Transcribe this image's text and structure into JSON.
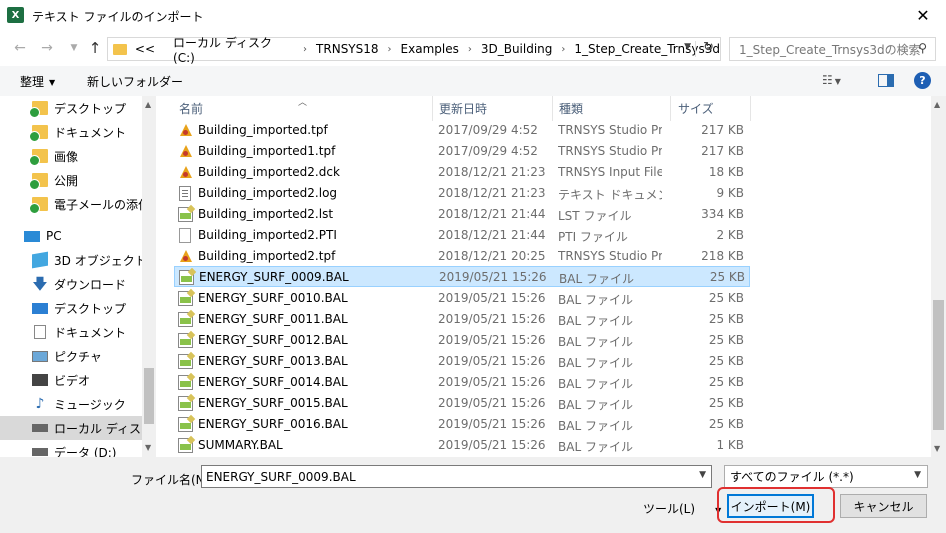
{
  "window": {
    "app_icon_letter": "X",
    "title": "テキスト ファイルのインポート",
    "close_glyph": "✕"
  },
  "address_bar": {
    "overflow": "<<",
    "crumbs": [
      "ローカル ディスク (C:)",
      "TRNSYS18",
      "Examples",
      "3D_Building",
      "1_Step_Create_Trnsys3d"
    ],
    "search_placeholder": "1_Step_Create_Trnsys3dの検索"
  },
  "toolbar": {
    "organize_label": "整理",
    "new_folder_label": "新しいフォルダー"
  },
  "nav_pane": {
    "items": [
      {
        "label": "デスクトップ",
        "icon": "folder-icon"
      },
      {
        "label": "ドキュメント",
        "icon": "folder-icon"
      },
      {
        "label": "画像",
        "icon": "folder-icon"
      },
      {
        "label": "公開",
        "icon": "folder-icon"
      },
      {
        "label": "電子メールの添付",
        "icon": "folder-icon"
      },
      {
        "label": "PC",
        "icon": "pc-icon"
      },
      {
        "label": "3D オブジェクト",
        "icon": "3d-objects-icon"
      },
      {
        "label": "ダウンロード",
        "icon": "download-icon"
      },
      {
        "label": "デスクトップ",
        "icon": "desktop-icon"
      },
      {
        "label": "ドキュメント",
        "icon": "documents-icon"
      },
      {
        "label": "ピクチャ",
        "icon": "pictures-icon"
      },
      {
        "label": "ビデオ",
        "icon": "video-icon"
      },
      {
        "label": "ミュージック",
        "icon": "music-icon"
      },
      {
        "label": "ローカル ディスク (C",
        "icon": "drive-icon",
        "selected": true
      },
      {
        "label": "データ (D:)",
        "icon": "drive-icon"
      }
    ]
  },
  "file_list": {
    "columns": [
      "名前",
      "更新日時",
      "種類",
      "サイズ"
    ],
    "rows": [
      {
        "name": "Building_imported.tpf",
        "date": "2017/09/29 4:52",
        "type": "TRNSYS Studio Pr...",
        "size": "217 KB",
        "icon": "trnsys-file-icon"
      },
      {
        "name": "Building_imported1.tpf",
        "date": "2017/09/29 4:52",
        "type": "TRNSYS Studio Pr...",
        "size": "217 KB",
        "icon": "trnsys-file-icon"
      },
      {
        "name": "Building_imported2.dck",
        "date": "2018/12/21 21:23",
        "type": "TRNSYS Input File",
        "size": "18 KB",
        "icon": "trnsys-file-icon"
      },
      {
        "name": "Building_imported2.log",
        "date": "2018/12/21 21:23",
        "type": "テキスト ドキュメント",
        "size": "9 KB",
        "icon": "text-file-icon"
      },
      {
        "name": "Building_imported2.lst",
        "date": "2018/12/21 21:44",
        "type": "LST ファイル",
        "size": "334 KB",
        "icon": "data-file-icon"
      },
      {
        "name": "Building_imported2.PTI",
        "date": "2018/12/21 21:44",
        "type": "PTI ファイル",
        "size": "2 KB",
        "icon": "blank-file-icon"
      },
      {
        "name": "Building_imported2.tpf",
        "date": "2018/12/21 20:25",
        "type": "TRNSYS Studio Pr...",
        "size": "218 KB",
        "icon": "trnsys-file-icon"
      },
      {
        "name": "ENERGY_SURF_0009.BAL",
        "date": "2019/05/21 15:26",
        "type": "BAL ファイル",
        "size": "25 KB",
        "icon": "data-file-icon",
        "selected": true
      },
      {
        "name": "ENERGY_SURF_0010.BAL",
        "date": "2019/05/21 15:26",
        "type": "BAL ファイル",
        "size": "25 KB",
        "icon": "data-file-icon"
      },
      {
        "name": "ENERGY_SURF_0011.BAL",
        "date": "2019/05/21 15:26",
        "type": "BAL ファイル",
        "size": "25 KB",
        "icon": "data-file-icon"
      },
      {
        "name": "ENERGY_SURF_0012.BAL",
        "date": "2019/05/21 15:26",
        "type": "BAL ファイル",
        "size": "25 KB",
        "icon": "data-file-icon"
      },
      {
        "name": "ENERGY_SURF_0013.BAL",
        "date": "2019/05/21 15:26",
        "type": "BAL ファイル",
        "size": "25 KB",
        "icon": "data-file-icon"
      },
      {
        "name": "ENERGY_SURF_0014.BAL",
        "date": "2019/05/21 15:26",
        "type": "BAL ファイル",
        "size": "25 KB",
        "icon": "data-file-icon"
      },
      {
        "name": "ENERGY_SURF_0015.BAL",
        "date": "2019/05/21 15:26",
        "type": "BAL ファイル",
        "size": "25 KB",
        "icon": "data-file-icon"
      },
      {
        "name": "ENERGY_SURF_0016.BAL",
        "date": "2019/05/21 15:26",
        "type": "BAL ファイル",
        "size": "25 KB",
        "icon": "data-file-icon"
      },
      {
        "name": "SUMMARY.BAL",
        "date": "2019/05/21 15:26",
        "type": "BAL ファイル",
        "size": "1 KB",
        "icon": "data-file-icon"
      }
    ]
  },
  "footer": {
    "filename_label": "ファイル名(N):",
    "filename_value": "ENERGY_SURF_0009.BAL",
    "filetype_value": "すべてのファイル (*.*)",
    "tools_label": "ツール(L)",
    "import_label": "インポート(M)",
    "cancel_label": "キャンセル"
  },
  "colors": {
    "selection_bg": "#cce8ff",
    "accent": "#0078d7",
    "highlight_outline": "#e03030"
  }
}
